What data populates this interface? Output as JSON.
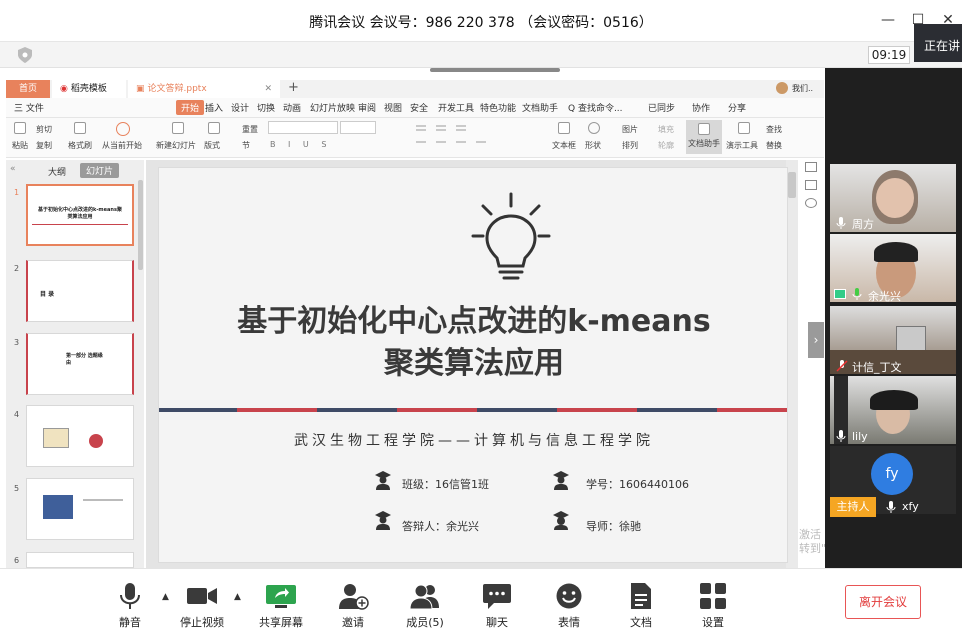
{
  "window": {
    "title": "腾讯会议 会议号：986 220 378 （会议密码：0516）",
    "clock": "09:19",
    "status_badge": "正在讲"
  },
  "wps": {
    "tabs": [
      {
        "label": "首页"
      },
      {
        "label": "稻壳模板"
      },
      {
        "label": "论文答辩.pptx"
      }
    ],
    "add_tab": "+",
    "user_label": "我们..",
    "menu_items": [
      "三 文件",
      "开始",
      "插入",
      "设计",
      "切换",
      "动画",
      "幻灯片放映",
      "审阅",
      "视图",
      "安全",
      "开发工具",
      "特色功能",
      "文档助手",
      "Q 查找命令...",
      "已同步",
      "协作",
      "分享"
    ],
    "ribbon": {
      "paste": "粘贴",
      "cut": "剪切",
      "copy": "复制",
      "format_painter": "格式刷",
      "from_current": "从当前开始",
      "new_slide": "新建幻灯片",
      "layout": "版式",
      "reset": "重置",
      "section": "节",
      "textbox": "文本框",
      "shape": "形状",
      "arrange": "排列",
      "picture": "图片",
      "fill": "填充",
      "outline": "轮廓",
      "doc_assist": "文档助手",
      "present_tools": "演示工具",
      "find": "查找",
      "replace": "替换"
    },
    "panel_tabs": [
      "大纲",
      "幻灯片"
    ],
    "thumbnails": [
      {
        "num": "1",
        "title": "基于初始化中心点改进的k-means聚类算法应用"
      },
      {
        "num": "2",
        "title": "目 录"
      },
      {
        "num": "3",
        "title": "第一部分 选题缘由"
      },
      {
        "num": "4",
        "title": ""
      },
      {
        "num": "5",
        "title": ""
      },
      {
        "num": "6",
        "title": ""
      }
    ]
  },
  "slide": {
    "title_line1": "基于初始化中心点改进的k-means",
    "title_line2": "聚类算法应用",
    "subtitle": "武汉生物工程学院——计算机与信息工程学院",
    "class_label": "班级：16信管1班",
    "id_label": "学号：1606440106",
    "defender_label": "答辩人：余光兴",
    "advisor_label": "导师：徐驰",
    "stripe_colors": [
      "#3f4b66",
      "#c8434c"
    ]
  },
  "participants": [
    {
      "name": "周方",
      "mic": "on"
    },
    {
      "name": "余光兴",
      "mic": "on",
      "sharing": true
    },
    {
      "name": "计信_丁文",
      "mic": "muted"
    },
    {
      "name": "lily",
      "mic": "on"
    },
    {
      "name": "xfy",
      "avatar": "fy",
      "host_badge": "主持人",
      "mic": "on"
    }
  ],
  "watermark": "激活\n转到\"",
  "toolbar": {
    "mute": "静音",
    "stop_video": "停止视频",
    "share_screen": "共享屏幕",
    "invite": "邀请",
    "members": "成员(5)",
    "chat": "聊天",
    "reaction": "表情",
    "docs": "文档",
    "settings": "设置",
    "leave": "离开会议"
  },
  "colors": {
    "accent": "#2f7de1",
    "host": "#f5a623",
    "leave": "#e23c3c",
    "wps_orange": "#e8825c"
  }
}
